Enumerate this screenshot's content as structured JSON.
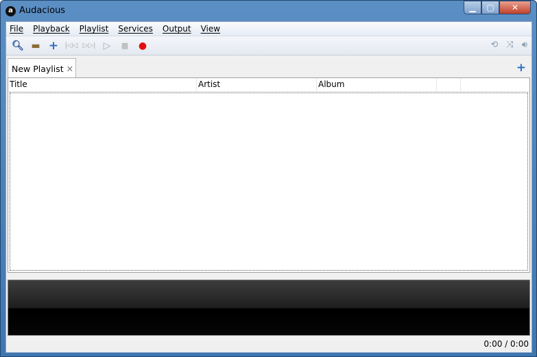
{
  "window": {
    "title": "Audacious",
    "logo": "a"
  },
  "menu": [
    "File",
    "Playback",
    "Playlist",
    "Services",
    "Output",
    "View"
  ],
  "tab": {
    "label": "New Playlist",
    "close": "✕"
  },
  "columns": [
    "Title",
    "Artist",
    "Album"
  ],
  "status": {
    "time": "0:00 / 0:00"
  }
}
